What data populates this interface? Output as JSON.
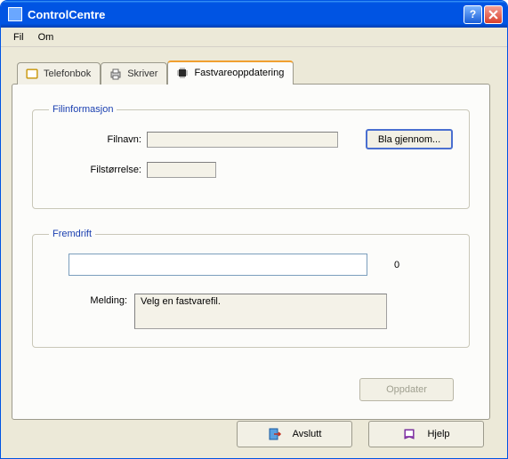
{
  "window": {
    "title": "ControlCentre"
  },
  "menu": {
    "file": "Fil",
    "about": "Om"
  },
  "tabs": {
    "phonebook": "Telefonbok",
    "printer": "Skriver",
    "firmware": "Fastvareoppdatering"
  },
  "fileinfo": {
    "legend": "Filinformasjon",
    "filename_label": "Filnavn:",
    "filesize_label": "Filstørrelse:",
    "filename_value": "",
    "filesize_value": "",
    "browse_label": "Bla gjennom..."
  },
  "progress": {
    "legend": "Fremdrift",
    "value": "0",
    "message_label": "Melding:",
    "message_value": "Velg en fastvarefil."
  },
  "buttons": {
    "update": "Oppdater",
    "exit": "Avslutt",
    "help": "Hjelp"
  }
}
